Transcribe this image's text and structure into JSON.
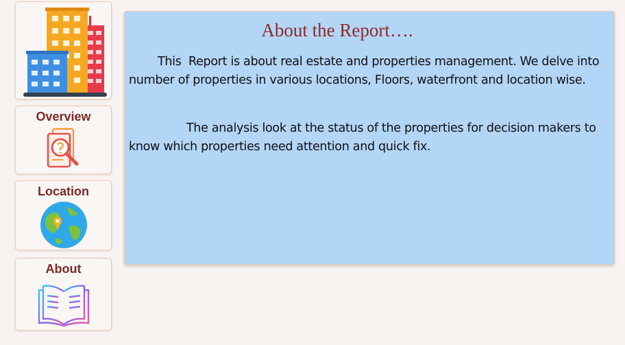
{
  "nav": {
    "home": {
      "icon": "buildings-icon"
    },
    "overview": {
      "label": "Overview",
      "icon": "report-magnifier-icon"
    },
    "location": {
      "label": "Location",
      "icon": "globe-pin-icon"
    },
    "about": {
      "label": "About",
      "icon": "open-book-icon"
    }
  },
  "panel": {
    "title": "About the Report….",
    "paragraph1": "        This  Report is about real estate and properties management. We delve into number of properties in various locations, Floors, waterfront and location wise.",
    "paragraph2": "                The analysis look at the status of the properties for decision makers to know which properties need attention and quick fix."
  },
  "colors": {
    "panel_bg": "#b3d5f6",
    "label": "#7a2a26",
    "title": "#8b2a28",
    "page_bg": "#f8f3f1"
  }
}
